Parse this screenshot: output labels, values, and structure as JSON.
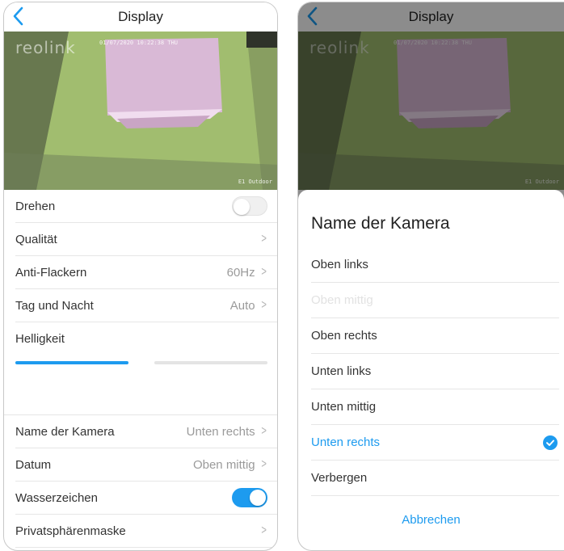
{
  "left": {
    "nav": {
      "title": "Display"
    },
    "camera": {
      "logo": "reolink",
      "timestamp": "01/07/2020 10:22:38 THU",
      "name": "E1 Outdoor"
    },
    "rows": {
      "drehen": {
        "label": "Drehen",
        "toggle_on": false
      },
      "qualitaet": {
        "label": "Qualität"
      },
      "anti_flackern": {
        "label": "Anti-Flackern",
        "value": "60Hz"
      },
      "tag_nacht": {
        "label": "Tag und Nacht",
        "value": "Auto"
      },
      "helligkeit": {
        "label": "Helligkeit",
        "slider_fraction": 0.5
      },
      "name_kamera": {
        "label": "Name der Kamera",
        "value": "Unten rechts"
      },
      "datum": {
        "label": "Datum",
        "value": "Oben mittig"
      },
      "wasserzeichen": {
        "label": "Wasserzeichen",
        "toggle_on": true
      },
      "privat": {
        "label": "Privatsphärenmaske"
      }
    }
  },
  "right": {
    "nav": {
      "title": "Display"
    },
    "camera": {
      "logo": "reolink",
      "timestamp": "01/07/2020 10:22:38 THU",
      "name": "E1 Outdoor"
    },
    "sheet": {
      "title": "Name der Kamera",
      "options": [
        {
          "label": "Oben links",
          "state": "normal"
        },
        {
          "label": "Oben mittig",
          "state": "disabled"
        },
        {
          "label": "Oben rechts",
          "state": "normal"
        },
        {
          "label": "Unten links",
          "state": "normal"
        },
        {
          "label": "Unten mittig",
          "state": "normal"
        },
        {
          "label": "Unten rechts",
          "state": "selected"
        },
        {
          "label": "Verbergen",
          "state": "normal"
        }
      ],
      "cancel": "Abbrechen"
    }
  },
  "colors": {
    "accent": "#1d9bef",
    "text": "#333333",
    "secondary": "#9a9a9a",
    "divider": "#e6e6e6"
  }
}
